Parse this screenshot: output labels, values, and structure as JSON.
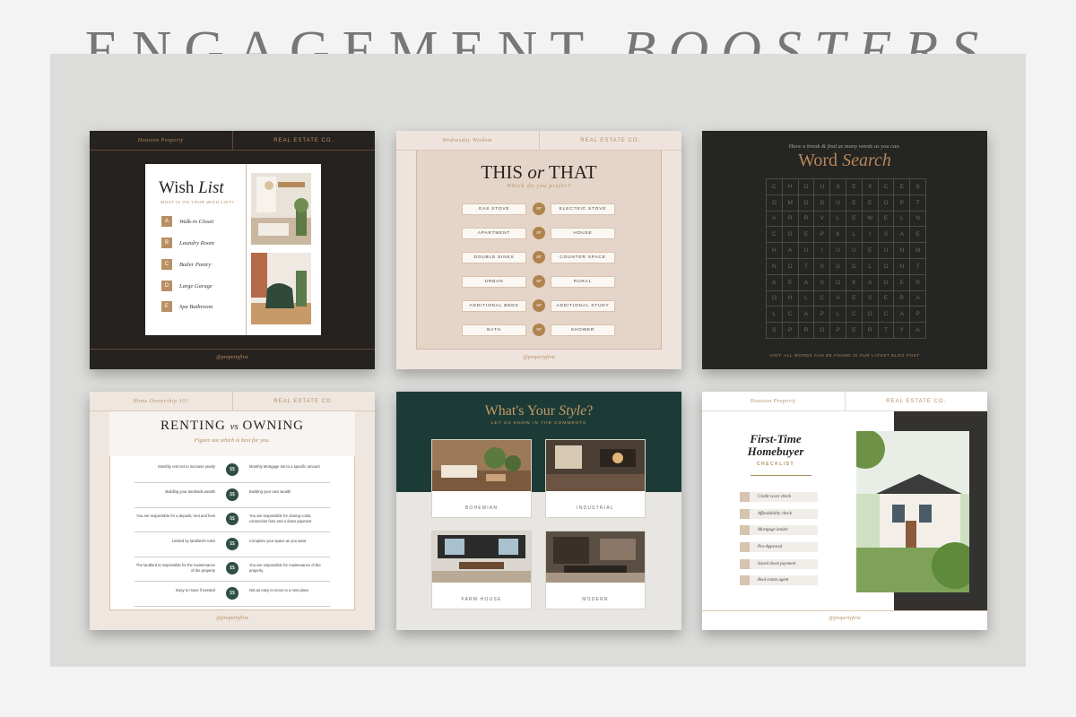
{
  "headline": {
    "part1": "ENGAGEMENT",
    "part2": "BOOSTERS"
  },
  "cards": {
    "wish_list": {
      "top_left": "Houston Property",
      "top_right": "REAL ESTATE CO.",
      "title_a": "Wish ",
      "title_b": "List",
      "subtitle": "WHAT IS ON YOUR WISH LIST?",
      "items": [
        {
          "letter": "A",
          "text": "Walk-in Closet"
        },
        {
          "letter": "B",
          "text": "Laundry Room"
        },
        {
          "letter": "C",
          "text": "Butler Pantry"
        },
        {
          "letter": "D",
          "text": "Large Garage"
        },
        {
          "letter": "E",
          "text": "Spa Bathroom"
        }
      ],
      "handle": "@propertyfirst"
    },
    "this_or_that": {
      "top_left": "Wednesday Wisdom",
      "top_right": "REAL ESTATE CO.",
      "title_a": "THIS ",
      "title_b": "or",
      "title_c": " THAT",
      "subtitle": "Which do you prefer?",
      "or_label": "or",
      "pairs": [
        {
          "left": "GAS STOVE",
          "right": "ELECTRIC STOVE"
        },
        {
          "left": "APARTMENT",
          "right": "HOUSE"
        },
        {
          "left": "DOUBLE SINKS",
          "right": "COUNTER SPACE"
        },
        {
          "left": "URBAN",
          "right": "RURAL"
        },
        {
          "left": "ADDITIONAL BEDS",
          "right": "ADDITIONAL STUDY"
        },
        {
          "left": "BATH",
          "right": "SHOWER"
        }
      ],
      "handle": "@propertyfirst"
    },
    "word_search": {
      "pre_title": "Have a break & find as many words as you can.",
      "title_a": "Word ",
      "title_b": "Search",
      "rows": [
        "CHOUSEXCES",
        "OMODUEEOPT",
        "ARRVLEWELN",
        "CGEPKLISAE",
        "HAUIUUEUNM",
        "NDTSGDLONT",
        "AEASOKAGER",
        "OHLCAESERA",
        "LCAPLCOCAP",
        "SPROPERTYA"
      ],
      "hint": "HINT: ALL WORDS CAN BE FOUND IN OUR LATEST BLOG POST"
    },
    "renting_owning": {
      "top_left": "Home Ownership 101",
      "top_right": "REAL ESTATE CO.",
      "title_a": "RENTING ",
      "title_b": "vs",
      "title_c": " OWNING",
      "subtitle": "Figure out which is best for you.",
      "badge": "$$",
      "rows": [
        {
          "left": "Monthly rent set to increase yearly",
          "right": "Monthly Mortgage set to a specific amount"
        },
        {
          "left": "Building your landlords wealth",
          "right": "Building your own wealth"
        },
        {
          "left": "You are responsible for a deposit, rent and fees",
          "right": "You are responsible for closing costs, connection fees and a down payment"
        },
        {
          "left": "Limited by landlord's rules",
          "right": "Complete your space as you want"
        },
        {
          "left": "The landlord is responsible for the maintenance of the property",
          "right": "You are responsible for maintenance of the property"
        },
        {
          "left": "Easy to move if needed",
          "right": "Not as easy to move to a new place"
        }
      ],
      "handle": "@propertyfirst"
    },
    "style": {
      "title_a": "What's Your ",
      "title_b": "Style",
      "title_c": "?",
      "subtitle": "LET US KNOW IN THE COMMENTS",
      "options": [
        "BOHEMIAN",
        "INDUSTRIAL",
        "FARM HOUSE",
        "MODERN"
      ]
    },
    "homebuyer": {
      "top_left": "Houston Property",
      "top_right": "REAL ESTATE CO.",
      "title_line1": "First-Time",
      "title_line2": "Homebuyer",
      "subtitle": "CHECKLIST",
      "items": [
        "Credit score check",
        "Affordability check",
        "Mortgage lender",
        "Pre-Approval",
        "Saved down payment",
        "Real estate agent"
      ],
      "handle": "@propertyfirst"
    }
  },
  "colors": {
    "gold": "#b99063",
    "dark": "#26221f",
    "green": "#1d3b36",
    "blush": "#efe4dd"
  }
}
